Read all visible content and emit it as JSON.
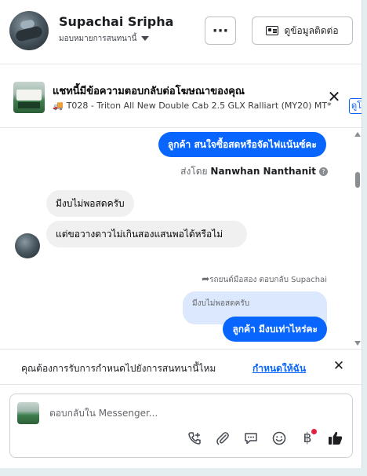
{
  "header": {
    "name": "Supachai Sripha",
    "assign_label": "มอบหมายการสนทนานี้",
    "more_label": "···",
    "contact_label": "ดูข้อมูลติดต่อ"
  },
  "ad": {
    "title": "แชทนี้มีข้อความตอบกลับต่อโฆษณาของคุณ",
    "subtitle": "T028 - Triton All New Double Cab 2.5 GLX Ralliart (MY20) MT*",
    "close": "✕",
    "view_label": "ดูโ"
  },
  "messages": {
    "outgoing_1": "ลูกค้า  สนใจซื้อสดหรือจัดไฟแน้นซ์คะ",
    "sent_by_prefix": "ส่งโดย",
    "sent_by_name": "Nanwhan Nanthanit",
    "incoming_1": "มีงบไม่พอสดครับ",
    "incoming_2": "แต่ขอวางดาวไม่เกินสองแสนพอได้หรือไม่",
    "reply_meta": "รถยนต์มือสอง ตอบกลับ Supachai",
    "quoted": "มีงบไม่พอสดครับ",
    "outgoing_2": "ลูกค้า  มีงบเท่าไหร่คะ"
  },
  "assign_prompt": {
    "text": "คุณต้องการรับการกำหนดไปยังการสนทนานี้ไหม",
    "link": "กำหนดให้ฉัน",
    "close": "✕"
  },
  "composer": {
    "placeholder": "ตอบกลับใน Messenger..."
  },
  "colors": {
    "accent": "#0866ff",
    "bubble_in": "#f0f0f0",
    "badge": "#e41e3f"
  },
  "icons": [
    "call-add-icon",
    "attachment-icon",
    "saved-reply-icon",
    "emoji-icon",
    "payment-icon",
    "like-icon"
  ]
}
